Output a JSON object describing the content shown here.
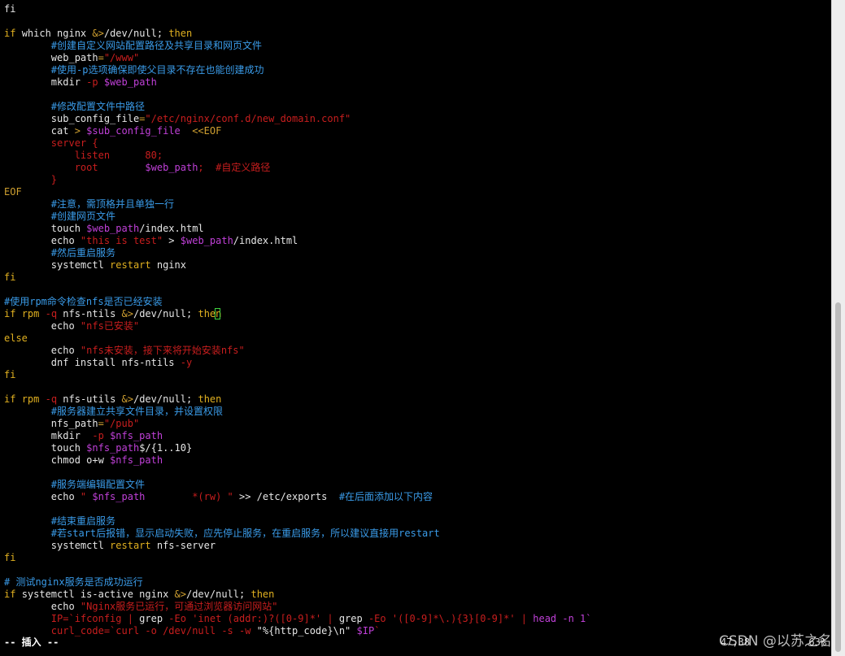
{
  "editor": {
    "lines": [
      [
        [
          "fi",
          "def"
        ]
      ],
      [],
      [
        [
          "if ",
          "kw"
        ],
        [
          "which nginx ",
          "def"
        ],
        [
          "&>",
          "op"
        ],
        [
          "/dev/null; ",
          "def"
        ],
        [
          "then",
          "kw"
        ]
      ],
      [
        [
          "        #创建自定义网站配置路径及共享目录和网页文件",
          "cmt"
        ]
      ],
      [
        [
          "        web_path",
          "def"
        ],
        [
          "=",
          "op"
        ],
        [
          "\"/www\"",
          "str"
        ]
      ],
      [
        [
          "        #使用-p选项确保即使父目录不存在也能创建成功",
          "cmt"
        ]
      ],
      [
        [
          "        mkdir ",
          "def"
        ],
        [
          "-p ",
          "str"
        ],
        [
          "$web_path",
          "var"
        ]
      ],
      [],
      [
        [
          "        #修改配置文件中路径",
          "cmt"
        ]
      ],
      [
        [
          "        sub_config_file",
          "def"
        ],
        [
          "=",
          "op"
        ],
        [
          "\"/etc/nginx/conf.d/new_domain.conf\"",
          "str"
        ]
      ],
      [
        [
          "        cat ",
          "def"
        ],
        [
          "> ",
          "op"
        ],
        [
          "$sub_config_file",
          "var"
        ],
        [
          "  <<EOF",
          "op"
        ]
      ],
      [
        [
          "        server {",
          "str"
        ]
      ],
      [
        [
          "            listen      80;",
          "str"
        ]
      ],
      [
        [
          "            root        ",
          "str"
        ],
        [
          "$web_path",
          "var"
        ],
        [
          ";  ",
          "str"
        ],
        [
          "#自定义路径",
          "str"
        ]
      ],
      [
        [
          "        }",
          "str"
        ]
      ],
      [
        [
          "EOF",
          "op"
        ]
      ],
      [
        [
          "        #注意，需顶格并且单独一行",
          "cmt"
        ]
      ],
      [
        [
          "        #创建网页文件",
          "cmt"
        ]
      ],
      [
        [
          "        touch ",
          "def"
        ],
        [
          "$web_path",
          "var"
        ],
        [
          "/index.html",
          "def"
        ]
      ],
      [
        [
          "        echo ",
          "def"
        ],
        [
          "\"this is test\"",
          "str"
        ],
        [
          " > ",
          "def"
        ],
        [
          "$web_path",
          "var"
        ],
        [
          "/index.html",
          "def"
        ]
      ],
      [
        [
          "        #然后重启服务",
          "cmt"
        ]
      ],
      [
        [
          "        systemctl ",
          "def"
        ],
        [
          "restart",
          "kw"
        ],
        [
          " nginx",
          "def"
        ]
      ],
      [
        [
          "fi",
          "kw"
        ]
      ],
      [],
      [
        [
          "#使用rpm命令检查nfs是否已经安装",
          "cmt"
        ]
      ],
      [
        [
          "if ",
          "kw"
        ],
        [
          "rpm ",
          "kw"
        ],
        [
          "-q ",
          "str"
        ],
        [
          "nfs-ntils ",
          "def"
        ],
        [
          "&>",
          "op"
        ],
        [
          "/dev/null; ",
          "def"
        ],
        [
          "then",
          "kw"
        ]
      ],
      [
        [
          "        echo ",
          "def"
        ],
        [
          "\"nfs已安装\"",
          "str"
        ]
      ],
      [
        [
          "else",
          "kw"
        ]
      ],
      [
        [
          "        echo ",
          "def"
        ],
        [
          "\"nfs未安装，接下来将开始安装nfs\"",
          "str"
        ]
      ],
      [
        [
          "        dnf install nfs-ntils ",
          "def"
        ],
        [
          "-y",
          "str"
        ]
      ],
      [
        [
          "fi",
          "kw"
        ]
      ],
      [],
      [
        [
          "if ",
          "kw"
        ],
        [
          "rpm ",
          "kw"
        ],
        [
          "-q ",
          "str"
        ],
        [
          "nfs-utils ",
          "def"
        ],
        [
          "&>",
          "op"
        ],
        [
          "/dev/null; ",
          "def"
        ],
        [
          "then",
          "kw"
        ]
      ],
      [
        [
          "        #服务器建立共享文件目录，并设置权限",
          "cmt"
        ]
      ],
      [
        [
          "        nfs_path",
          "def"
        ],
        [
          "=",
          "op"
        ],
        [
          "\"/pub\"",
          "str"
        ]
      ],
      [
        [
          "        mkdir  ",
          "def"
        ],
        [
          "-p ",
          "str"
        ],
        [
          "$nfs_path",
          "var"
        ]
      ],
      [
        [
          "        touch ",
          "def"
        ],
        [
          "$nfs_path",
          "var"
        ],
        [
          "$/{1..10}",
          "def"
        ]
      ],
      [
        [
          "        chmod ",
          "def"
        ],
        [
          "o+w ",
          "def"
        ],
        [
          "$nfs_path",
          "var"
        ]
      ],
      [],
      [
        [
          "        #服务端编辑配置文件",
          "cmt"
        ]
      ],
      [
        [
          "        echo ",
          "def"
        ],
        [
          "\" ",
          "str"
        ],
        [
          "$nfs_path",
          "var"
        ],
        [
          "        *(rw) \"",
          "str"
        ],
        [
          " >> /etc/exports  ",
          "def"
        ],
        [
          "#在后面添加以下内容",
          "cmt"
        ]
      ],
      [],
      [
        [
          "        #结束重启服务",
          "cmt"
        ]
      ],
      [
        [
          "        #若start后报错，显示启动失败，应先停止服务，在重启服务，所以建议直接用restart",
          "cmt"
        ]
      ],
      [
        [
          "        systemctl ",
          "def"
        ],
        [
          "restart",
          "kw"
        ],
        [
          " nfs-server",
          "def"
        ]
      ],
      [
        [
          "fi",
          "kw"
        ]
      ],
      [],
      [
        [
          "# 测试nginx服务是否成功运行",
          "cmt"
        ]
      ],
      [
        [
          "if ",
          "kw"
        ],
        [
          "systemctl is-active nginx ",
          "def"
        ],
        [
          "&>",
          "op"
        ],
        [
          "/dev/null; ",
          "def"
        ],
        [
          "then",
          "kw"
        ]
      ],
      [
        [
          "        echo ",
          "def"
        ],
        [
          "\"Nginx服务已运行，可通过浏览器访问网站\"",
          "str"
        ]
      ],
      [
        [
          "        IP",
          "str"
        ],
        [
          "=`ifconfig | ",
          "str"
        ],
        [
          "grep ",
          "def"
        ],
        [
          "-Eo ",
          "str"
        ],
        [
          "'inet (addr:)?([0-9]*' | ",
          "str"
        ],
        [
          "grep ",
          "def"
        ],
        [
          "-Eo ",
          "str"
        ],
        [
          "'([0-9]*\\.){3}[0-9]*' | ",
          "str"
        ],
        [
          "head -n 1`",
          "var"
        ]
      ],
      [
        [
          "        curl_code",
          "str"
        ],
        [
          "=`curl -o /dev/null -s -w ",
          "str"
        ],
        [
          "\"%{http_code}\\n\" ",
          "def"
        ],
        [
          "$IP",
          "var"
        ],
        [
          "`",
          "str"
        ]
      ]
    ]
  },
  "status": {
    "mode": "-- 插入 --",
    "ruler_pos": "47,38",
    "ruler_pct": "63%"
  },
  "watermark": "CSDN @以苏之名",
  "colors": {
    "default": "#e6e6e6",
    "keyword": "#e0b020",
    "comment": "#3a9be8",
    "variable": "#c040d8",
    "string": "#c81e1e",
    "operator": "#d0a030",
    "background": "#000000"
  }
}
